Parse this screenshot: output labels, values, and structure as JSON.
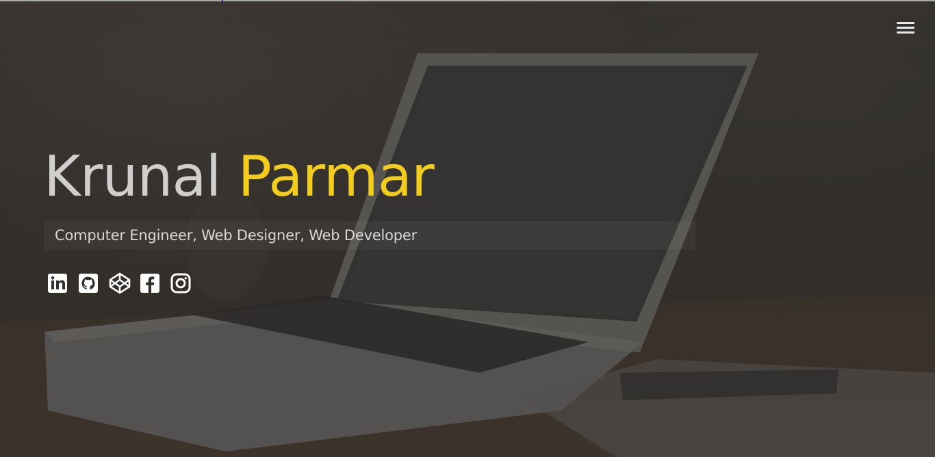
{
  "hero": {
    "first_name": "Krunal",
    "last_name": "Parmar",
    "tagline": "Computer Engineer, Web Designer, Web Developer"
  },
  "nav": {
    "menu_icon": "hamburger-menu-icon"
  },
  "social": [
    {
      "name": "linkedin",
      "icon": "linkedin-icon"
    },
    {
      "name": "github",
      "icon": "github-icon"
    },
    {
      "name": "codepen",
      "icon": "codepen-icon"
    },
    {
      "name": "facebook",
      "icon": "facebook-icon"
    },
    {
      "name": "instagram",
      "icon": "instagram-icon"
    }
  ],
  "colors": {
    "accent": "#f3cd1e",
    "name_primary": "#d0cfcd",
    "tagline_text": "#d9d8d6",
    "icon": "#ffffff",
    "background": "#35302d"
  }
}
